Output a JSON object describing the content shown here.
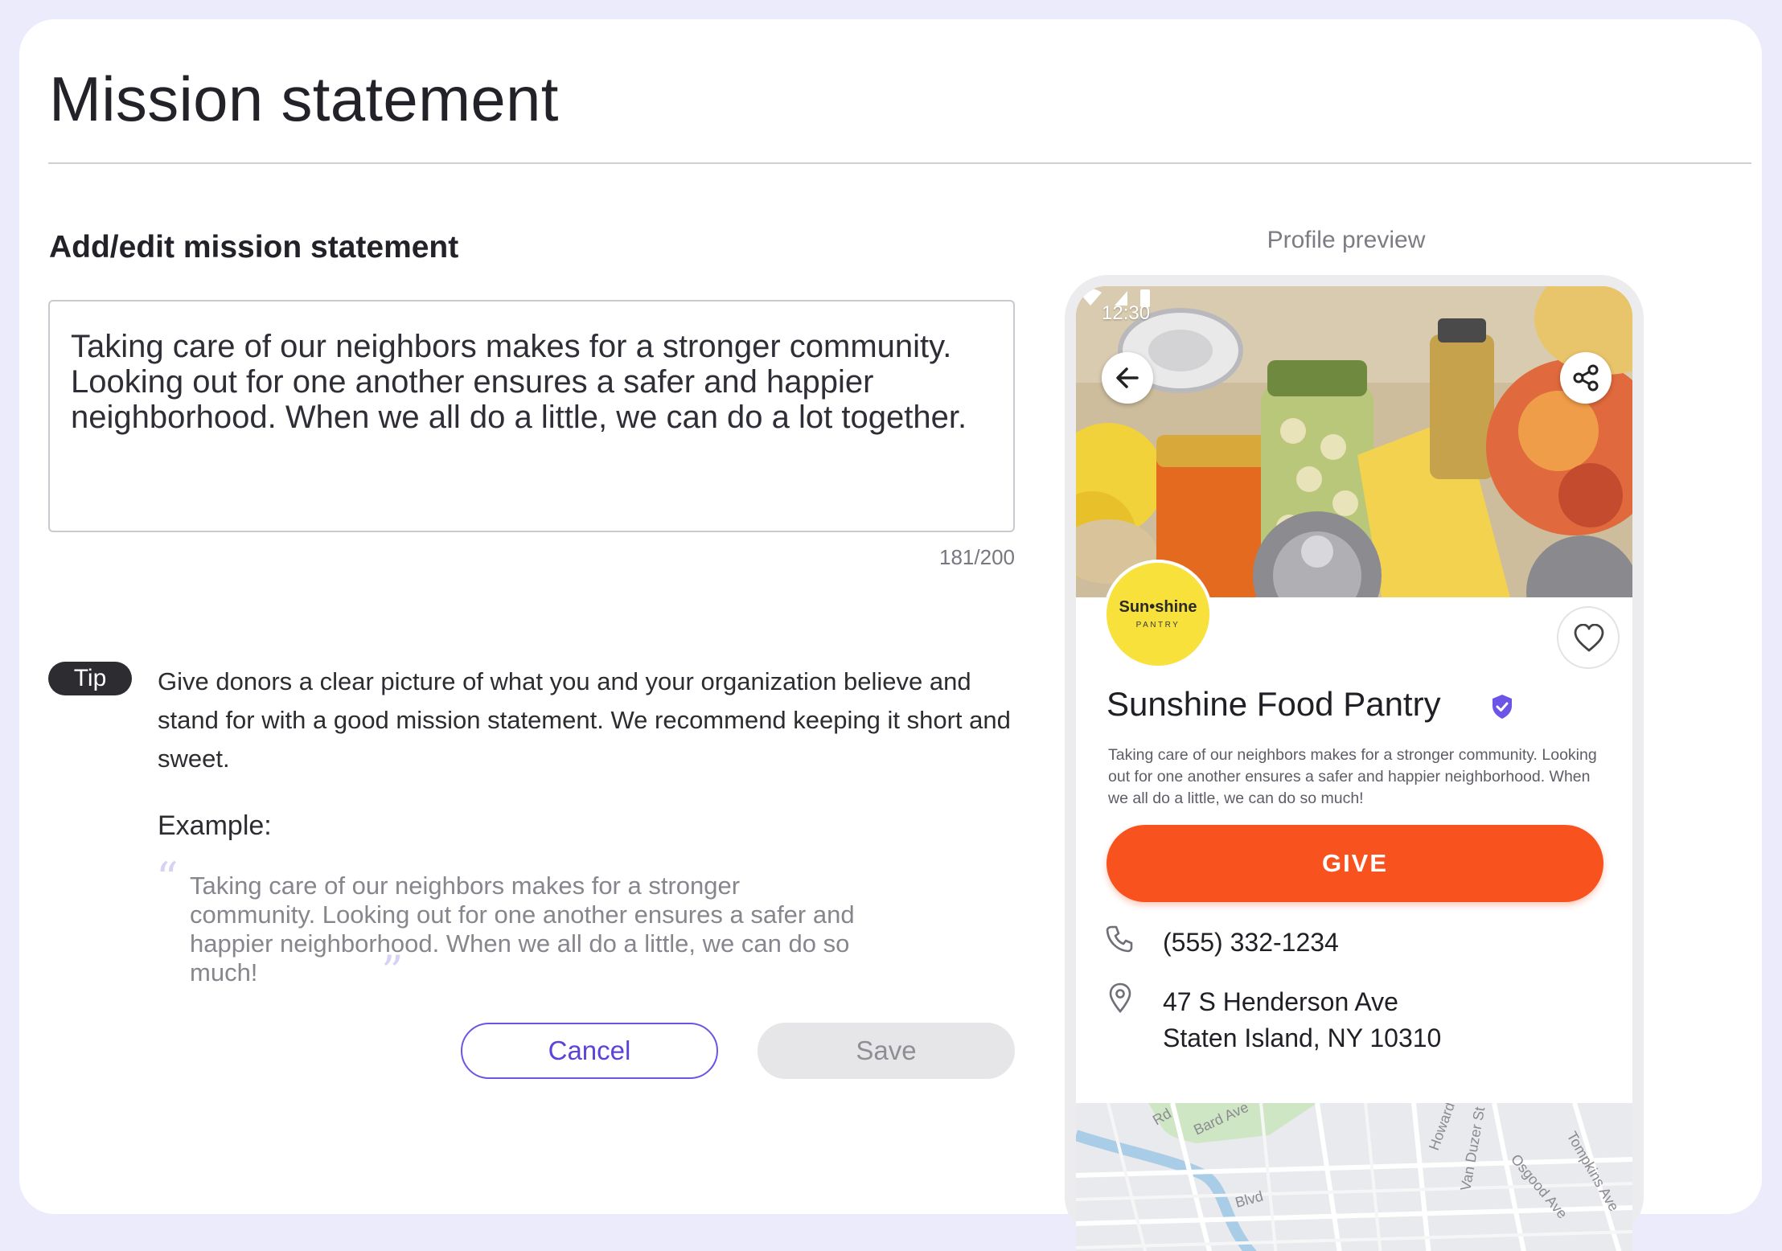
{
  "page": {
    "title": "Mission statement",
    "section_title": "Add/edit mission statement"
  },
  "editor": {
    "value": "Taking care of our neighbors makes for a stronger community. Looking out for one another ensures a safer and happier neighborhood. When we all do a little, we can do a lot together.",
    "counter": "181/200"
  },
  "tip": {
    "badge": "Tip",
    "text": "Give donors a clear picture of what you and your organization believe and stand for with a good mission statement. We recommend keeping it short and sweet.",
    "example_label": "Example:",
    "example_text": "Taking care of our neighbors makes for a stronger community. Looking out for one another ensures a safer and happier neighborhood. When we all do a little, we can do so much!",
    "quote_open": "“",
    "quote_close": "”"
  },
  "actions": {
    "cancel_label": "Cancel",
    "save_label": "Save"
  },
  "preview": {
    "label": "Profile preview",
    "status_time": "12:30",
    "logo_name": "Sun•shine",
    "logo_sub": "PANTRY",
    "org_name": "Sunshine Food Pantry",
    "description": "Taking care of our neighbors makes for a stronger community. Looking out for one another ensures a safer and happier neighborhood. When we all do a little, we can do so much!",
    "give_label": "GIVE",
    "phone": "(555) 332-1234",
    "address_line1": "47 S Henderson Ave",
    "address_line2": "Staten Island, NY 10310",
    "map_labels": [
      "Rd",
      "Bard Ave",
      "Howard",
      "Van Duzer St",
      "Osgood Ave",
      "Tompkins Ave",
      "Blvd"
    ]
  },
  "colors": {
    "accent": "#6c54e6",
    "give": "#f8531f",
    "logo_yellow": "#f7e13a",
    "verified": "#6c54e6"
  }
}
